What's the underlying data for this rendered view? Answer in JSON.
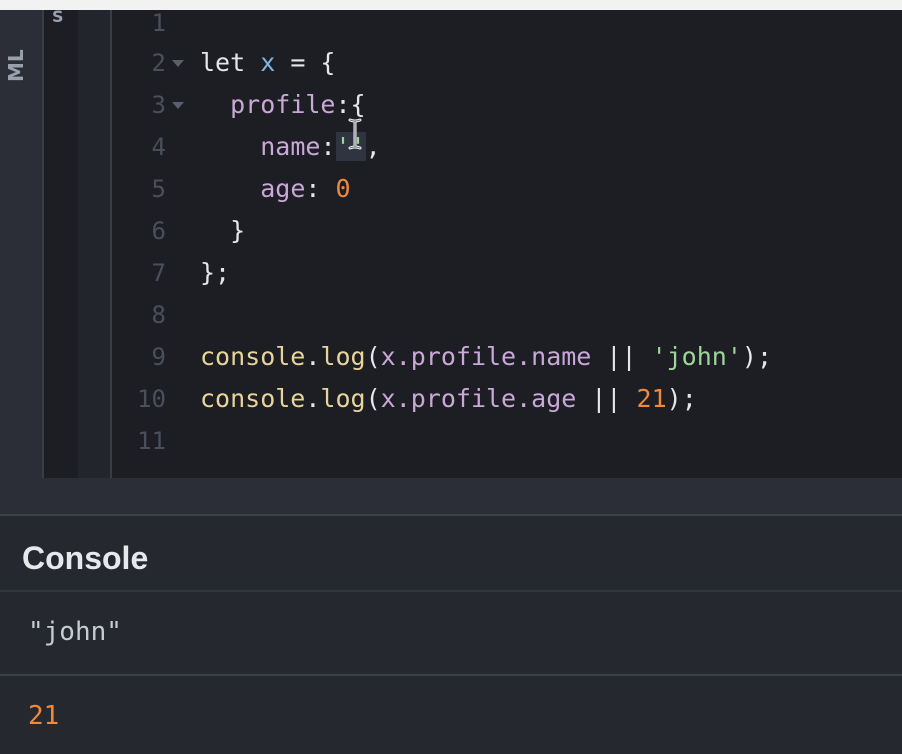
{
  "left_panel": {
    "label": "ML",
    "top_label": "S"
  },
  "editor": {
    "line_numbers": [
      "1",
      "2",
      "3",
      "4",
      "5",
      "6",
      "7",
      "8",
      "9",
      "10",
      "11"
    ],
    "lines": {
      "l2": {
        "kw": "let",
        "var": "x",
        "rest": " = {"
      },
      "l3": {
        "prop": "profile",
        "rest": ":{"
      },
      "l4": {
        "prop": "name",
        "colon": ":",
        "str": "''",
        "comma": ","
      },
      "l5": {
        "prop": "age",
        "colon": ": ",
        "num": "0"
      },
      "l6": {
        "text": "}"
      },
      "l7": {
        "text": "};"
      },
      "l9": {
        "fn": "console",
        "dot": ".",
        "log": "log",
        "open": "(",
        "expr": "x.profile.name",
        "op": " || ",
        "arg": "'john'",
        "close": ");"
      },
      "l10": {
        "fn": "console",
        "dot": ".",
        "log": "log",
        "open": "(",
        "expr": "x.profile.age",
        "op": " || ",
        "arg": "21",
        "close": ");"
      }
    }
  },
  "console": {
    "title": "Console",
    "entries": [
      "\"john\"",
      "21"
    ]
  },
  "colors": {
    "background": "#1c1e24",
    "keyword": "#e4e6ea",
    "variable": "#7fb6e6",
    "property": "#c9a7d6",
    "function": "#e8d49a",
    "number": "#f08a3a",
    "string": "#9fd49a"
  },
  "icons": {
    "cursor": "text-cursor-icon",
    "fold": "fold-arrow-icon"
  }
}
